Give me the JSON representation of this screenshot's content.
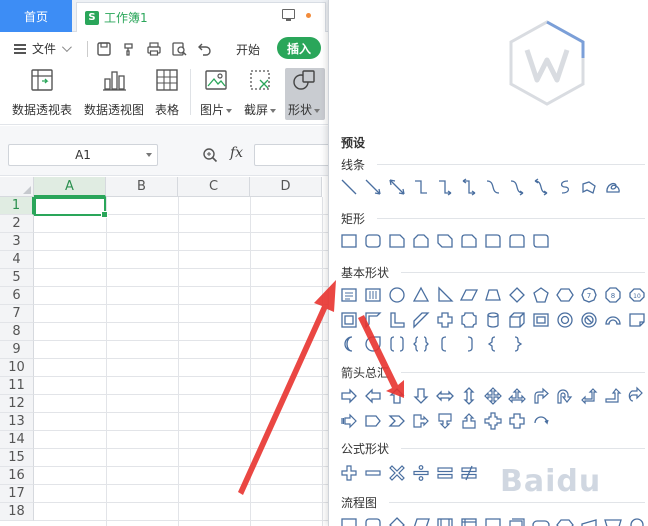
{
  "tabs": {
    "home": "首页",
    "doc_title": "工作簿1",
    "doc_icon_letter": "S"
  },
  "menu": {
    "file": "文件",
    "start": "开始",
    "insert": "插入"
  },
  "ribbon": {
    "pivot_table": "数据透视表",
    "pivot_chart": "数据透视图",
    "table": "表格",
    "picture": "图片",
    "screenshot": "截屏",
    "shape": "形状"
  },
  "formula": {
    "cell_ref": "A1",
    "fx": "fx"
  },
  "columns": [
    "A",
    "B",
    "C",
    "D"
  ],
  "rows": [
    "1",
    "2",
    "3",
    "4",
    "5",
    "6",
    "7",
    "8",
    "9",
    "10",
    "11",
    "12",
    "13",
    "14",
    "15",
    "16",
    "17",
    "18"
  ],
  "panel": {
    "preset": "预设",
    "lines": "线条",
    "rect": "矩形",
    "basic": "基本形状",
    "arrows": "箭头总汇",
    "formula_shapes": "公式形状",
    "flowchart": "流程图"
  },
  "watermark": "Baidu",
  "colors": {
    "accent_green": "#2aa65a",
    "home_tab_blue": "#3d8df5",
    "shape_stroke": "#4a6fa0",
    "annotation_arrow": "#e8332f"
  }
}
